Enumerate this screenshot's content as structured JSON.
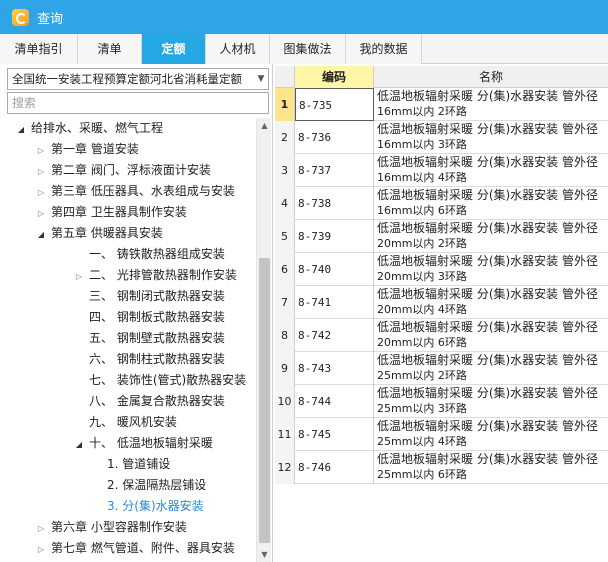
{
  "window": {
    "title": "查询",
    "icon": "app-logo-icon"
  },
  "tabs": [
    {
      "label": "清单指引",
      "active": false
    },
    {
      "label": "清单",
      "active": false
    },
    {
      "label": "定额",
      "active": true
    },
    {
      "label": "人材机",
      "active": false
    },
    {
      "label": "图集做法",
      "active": false
    },
    {
      "label": "我的数据",
      "active": false
    }
  ],
  "left": {
    "quota_book": "全国统一安装工程预算定额河北省消耗量定额",
    "search_placeholder": "搜索",
    "tree": [
      {
        "label": "给排水、采暖、燃气工程",
        "level": 0,
        "toggle": "open"
      },
      {
        "label": "第一章 管道安装",
        "level": 1,
        "toggle": "closed"
      },
      {
        "label": "第二章 阀门、浮标液面计安装",
        "level": 1,
        "toggle": "closed"
      },
      {
        "label": "第三章 低压器具、水表组成与安装",
        "level": 1,
        "toggle": "closed"
      },
      {
        "label": "第四章 卫生器具制作安装",
        "level": 1,
        "toggle": "closed"
      },
      {
        "label": "第五章 供暖器具安装",
        "level": 1,
        "toggle": "open"
      },
      {
        "label": "一、 铸铁散热器组成安装",
        "level": 2,
        "toggle": "none"
      },
      {
        "label": "二、 光排管散热器制作安装",
        "level": 2,
        "toggle": "closed"
      },
      {
        "label": "三、 钢制闭式散热器安装",
        "level": 2,
        "toggle": "none"
      },
      {
        "label": "四、 钢制板式散热器安装",
        "level": 2,
        "toggle": "none"
      },
      {
        "label": "五、 钢制壁式散热器安装",
        "level": 2,
        "toggle": "none"
      },
      {
        "label": "六、 钢制柱式散热器安装",
        "level": 2,
        "toggle": "none"
      },
      {
        "label": "七、 装饰性(管式)散热器安装",
        "level": 2,
        "toggle": "none"
      },
      {
        "label": "八、 金属复合散热器安装",
        "level": 2,
        "toggle": "none"
      },
      {
        "label": "九、 暖风机安装",
        "level": 2,
        "toggle": "none"
      },
      {
        "label": "十、 低温地板辐射采暖",
        "level": 2,
        "toggle": "open"
      },
      {
        "label": "1. 管道铺设",
        "level": 3,
        "toggle": "none"
      },
      {
        "label": "2. 保温隔热层铺设",
        "level": 3,
        "toggle": "none"
      },
      {
        "label": "3. 分(集)水器安装",
        "level": 3,
        "toggle": "none",
        "selected": true
      },
      {
        "label": "第六章 小型容器制作安装",
        "level": 1,
        "toggle": "closed"
      },
      {
        "label": "第七章 燃气管道、附件、器具安装",
        "level": 1,
        "toggle": "closed"
      }
    ]
  },
  "table": {
    "col_code": "编码",
    "col_name": "名称",
    "rows": [
      {
        "num": "1",
        "code": "8-735",
        "name1": "低温地板辐射采暖 分(集)水器安装 管外径",
        "name2": "16mm以内 2环路",
        "selected": true
      },
      {
        "num": "2",
        "code": "8-736",
        "name1": "低温地板辐射采暖 分(集)水器安装 管外径",
        "name2": "16mm以内 3环路"
      },
      {
        "num": "3",
        "code": "8-737",
        "name1": "低温地板辐射采暖 分(集)水器安装 管外径",
        "name2": "16mm以内 4环路"
      },
      {
        "num": "4",
        "code": "8-738",
        "name1": "低温地板辐射采暖 分(集)水器安装 管外径",
        "name2": "16mm以内 6环路"
      },
      {
        "num": "5",
        "code": "8-739",
        "name1": "低温地板辐射采暖 分(集)水器安装 管外径",
        "name2": "20mm以内 2环路"
      },
      {
        "num": "6",
        "code": "8-740",
        "name1": "低温地板辐射采暖 分(集)水器安装 管外径",
        "name2": "20mm以内 3环路"
      },
      {
        "num": "7",
        "code": "8-741",
        "name1": "低温地板辐射采暖 分(集)水器安装 管外径",
        "name2": "20mm以内 4环路"
      },
      {
        "num": "8",
        "code": "8-742",
        "name1": "低温地板辐射采暖 分(集)水器安装 管外径",
        "name2": "20mm以内 6环路"
      },
      {
        "num": "9",
        "code": "8-743",
        "name1": "低温地板辐射采暖 分(集)水器安装 管外径",
        "name2": "25mm以内 2环路"
      },
      {
        "num": "10",
        "code": "8-744",
        "name1": "低温地板辐射采暖 分(集)水器安装 管外径",
        "name2": "25mm以内 3环路"
      },
      {
        "num": "11",
        "code": "8-745",
        "name1": "低温地板辐射采暖 分(集)水器安装 管外径",
        "name2": "25mm以内 4环路"
      },
      {
        "num": "12",
        "code": "8-746",
        "name1": "低温地板辐射采暖 分(集)水器安装 管外径",
        "name2": "25mm以内 6环路"
      }
    ]
  },
  "colors": {
    "titlebar": "#2fa4e7",
    "active_tab": "#23a8e4",
    "selected_tree": "#2a8ad6",
    "code_header": "#fff6a8"
  }
}
